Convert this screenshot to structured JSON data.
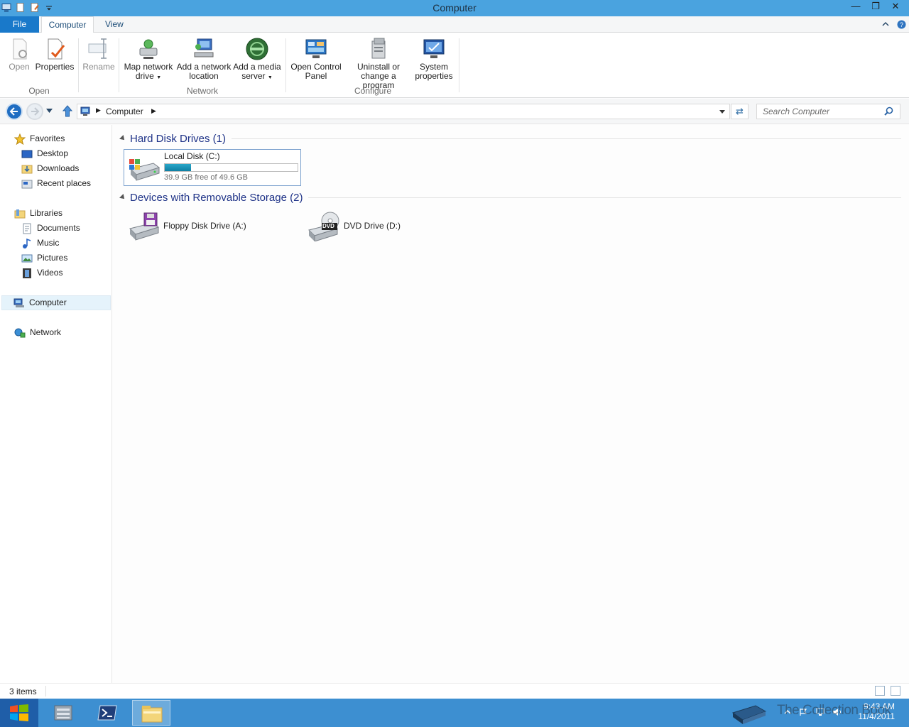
{
  "window": {
    "title": "Computer"
  },
  "tabs": {
    "file": "File",
    "computer": "Computer",
    "view": "View"
  },
  "ribbon": {
    "open": "Open",
    "properties": "Properties",
    "rename": "Rename",
    "group_open": "Open",
    "map_drive_1": "Map network",
    "map_drive_2": "drive",
    "add_loc_1": "Add a network",
    "add_loc_2": "location",
    "add_media_1": "Add a media",
    "add_media_2": "server",
    "group_network": "Network",
    "control_panel_1": "Open Control",
    "control_panel_2": "Panel",
    "uninstall_1": "Uninstall or",
    "uninstall_2": "change a program",
    "sysprops_1": "System",
    "sysprops_2": "properties",
    "group_configure": "Configure"
  },
  "address": {
    "crumb": "Computer",
    "search_placeholder": "Search Computer"
  },
  "nav": {
    "favorites": "Favorites",
    "desktop": "Desktop",
    "downloads": "Downloads",
    "recent": "Recent places",
    "libraries": "Libraries",
    "documents": "Documents",
    "music": "Music",
    "pictures": "Pictures",
    "videos": "Videos",
    "computer": "Computer",
    "network": "Network"
  },
  "content": {
    "group_hdd": "Hard Disk Drives (1)",
    "group_removable": "Devices with Removable Storage (2)",
    "local_disk": {
      "name": "Local Disk (C:)",
      "free": "39.9 GB free of 49.6 GB",
      "used_fraction": 0.196
    },
    "floppy": "Floppy Disk Drive (A:)",
    "dvd": "DVD Drive (D:)",
    "dvd_badge": "DVD"
  },
  "status": {
    "items": "3 items"
  },
  "taskbar": {
    "time": "9:43 AM",
    "date": "11/4/2011"
  },
  "watermark": "The Collection Book",
  "colors": {
    "titlebar": "#4aa3df",
    "file_tab": "#1979ca",
    "taskbar": "#3d8fd1",
    "group_header": "#1e3287",
    "disk_bar": "#1f90b8"
  }
}
